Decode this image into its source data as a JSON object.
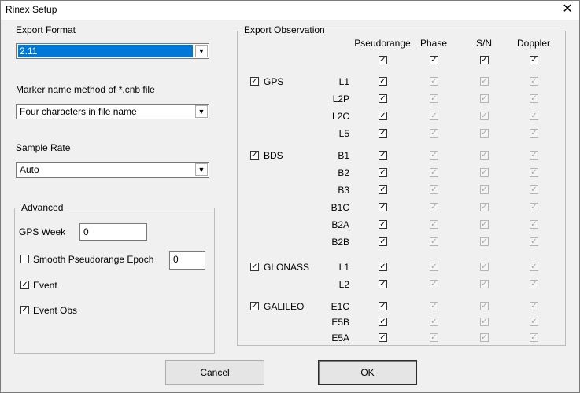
{
  "window": {
    "title": "Rinex Setup",
    "close_glyph": "✕"
  },
  "left": {
    "export_format": {
      "label": "Export Format",
      "value": "2.11"
    },
    "marker_name": {
      "label": "Marker name method of *.cnb file",
      "value": "Four characters in file name"
    },
    "sample_rate": {
      "label": "Sample Rate",
      "value": "Auto"
    },
    "advanced": {
      "title": "Advanced",
      "gps_week_label": "GPS Week",
      "gps_week_value": "0",
      "smooth_label": "Smooth Pseudorange Epoch",
      "smooth_checked": false,
      "smooth_value": "0",
      "event_label": "Event",
      "event_checked": true,
      "event_obs_label": "Event Obs",
      "event_obs_checked": true
    }
  },
  "observation": {
    "title": "Export Observation",
    "columns": [
      "Pseudorange",
      "Phase",
      "S/N",
      "Doppler"
    ],
    "header_checked": [
      true,
      true,
      true,
      true
    ],
    "systems": [
      {
        "name": "GPS",
        "checked": true,
        "bands": [
          "L1",
          "L2P",
          "L2C",
          "L5"
        ]
      },
      {
        "name": "BDS",
        "checked": true,
        "bands": [
          "B1",
          "B2",
          "B3",
          "B1C",
          "B2A",
          "B2B"
        ]
      },
      {
        "name": "GLONASS",
        "checked": true,
        "bands": [
          "L1",
          "L2"
        ]
      },
      {
        "name": "GALILEO",
        "checked": true,
        "bands": [
          "E1C",
          "E5B",
          "E5A"
        ]
      }
    ]
  },
  "buttons": {
    "cancel": "Cancel",
    "ok": "OK"
  },
  "check_glyph": "✓",
  "icons": {
    "combo_arrow": "▼"
  },
  "colors": {
    "selection": "#0078d7"
  }
}
